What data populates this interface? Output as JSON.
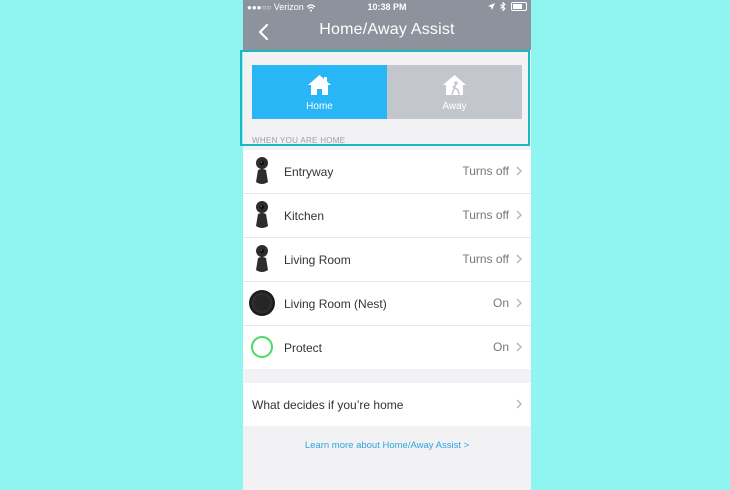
{
  "status_bar": {
    "signal_dots": "●●●○○",
    "carrier": "Verizon",
    "time": "10:38 PM"
  },
  "header": {
    "back_icon": "chevron-left-icon",
    "title": "Home/Away Assist"
  },
  "mode_toggle": {
    "selected": "Home",
    "home_label": "Home",
    "away_label": "Away",
    "home_color": "#29b6f6",
    "away_color": "#c3c7cd"
  },
  "section_label": "WHEN YOU ARE HOME",
  "devices": [
    {
      "name": "Entryway",
      "status": "Turns off",
      "icon": "camera-icon"
    },
    {
      "name": "Kitchen",
      "status": "Turns off",
      "icon": "camera-icon"
    },
    {
      "name": "Living Room",
      "status": "Turns off",
      "icon": "camera-icon"
    },
    {
      "name": "Living Room (Nest)",
      "status": "On",
      "icon": "thermostat-icon"
    },
    {
      "name": "Protect",
      "status": "On",
      "icon": "smoke-alarm-icon"
    }
  ],
  "decide_label": "What decides if you’re home",
  "learn_more": "Learn more about Home/Away Assist >",
  "colors": {
    "background": "#8ff5f0",
    "header": "#8d939d",
    "highlight_border": "#19b8c2",
    "link": "#2ea3e0"
  }
}
